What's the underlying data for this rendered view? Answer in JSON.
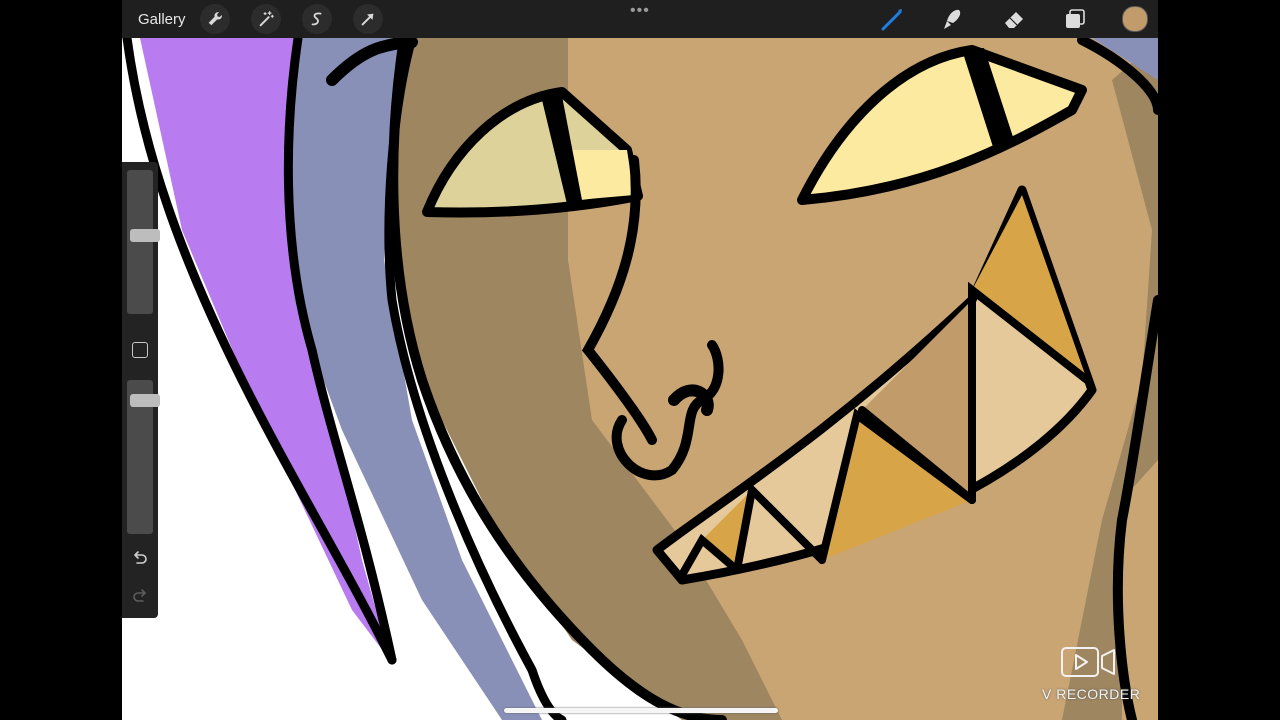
{
  "toolbar": {
    "gallery_label": "Gallery",
    "left_tools": [
      {
        "name": "actions",
        "icon": "wrench-icon"
      },
      {
        "name": "adjustments",
        "icon": "magic-wand-icon"
      },
      {
        "name": "selection",
        "icon": "selection-s-icon"
      },
      {
        "name": "transform",
        "icon": "arrow-cursor-icon"
      }
    ],
    "right_tools": [
      {
        "name": "brush",
        "icon": "brush-icon",
        "active": true
      },
      {
        "name": "smudge",
        "icon": "smudge-icon",
        "active": false
      },
      {
        "name": "eraser",
        "icon": "eraser-icon",
        "active": false
      },
      {
        "name": "layers",
        "icon": "layers-icon",
        "active": false
      }
    ],
    "current_color": "#c29b6a",
    "active_tool_color": "#1e7fe0"
  },
  "sidebar": {
    "brush_size_level": 0.55,
    "opacity_level": 0.9
  },
  "canvas": {
    "palette": {
      "hair_purple": "#b87cf0",
      "hair_blue": "#8890b8",
      "skin": "#c9a574",
      "skin_shadow": "#9e8660",
      "eye_light": "#fbeaa0",
      "eye_shadow": "#ddd39a",
      "tooth_gold": "#d7a548",
      "tooth_light": "#e5c99a",
      "line": "#000000"
    }
  },
  "watermark": {
    "text": "V RECORDER",
    "icon": "video-play-icon"
  }
}
